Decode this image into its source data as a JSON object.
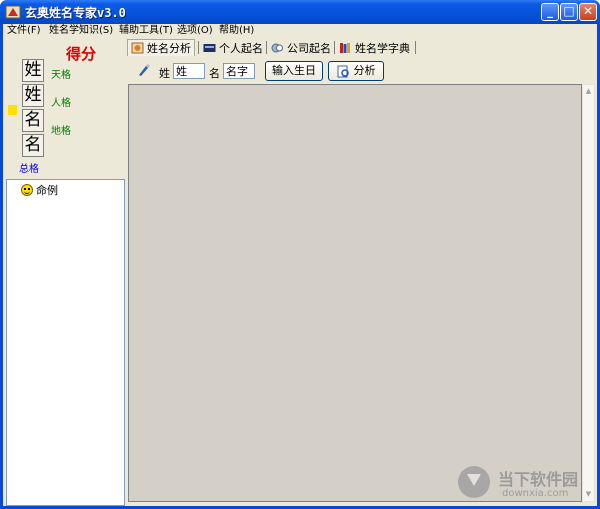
{
  "window": {
    "title": "玄奥姓名专家v3.0",
    "minimize": "_",
    "maximize": "□",
    "close": "✕"
  },
  "menu": [
    "文件(F)",
    "姓名学知识(S)",
    "辅助工具(T)",
    "选项(O)",
    "帮助(H)"
  ],
  "score_panel": {
    "score_title": "得分",
    "chars": [
      "姓",
      "姓",
      "名",
      "名"
    ],
    "tian": "天格",
    "ren": "人格",
    "di": "地格",
    "zong": "总格"
  },
  "tree": {
    "items": [
      {
        "label": "命例",
        "icon": "smiley-icon"
      }
    ]
  },
  "tabs": [
    {
      "label": "姓名分析",
      "icon": "name-analysis-icon",
      "active": true
    },
    {
      "label": "个人起名",
      "icon": "personal-naming-icon",
      "active": false
    },
    {
      "label": "公司起名",
      "icon": "company-naming-icon",
      "active": false
    },
    {
      "label": "姓名学字典",
      "icon": "dictionary-icon",
      "active": false
    }
  ],
  "toolbar": {
    "surname_label": "姓",
    "surname_value": "姓",
    "given_label": "名",
    "given_value": "名字",
    "birthday_button": "输入生日",
    "analyze_button": "分析"
  },
  "watermark": {
    "title": "当下软件园",
    "url": "downxia.com"
  },
  "colors": {
    "title_bar": "#0553d8",
    "score": "#e00000",
    "ge_green": "#008000",
    "zong_blue": "#0000ff",
    "face": "#ece9d8"
  }
}
